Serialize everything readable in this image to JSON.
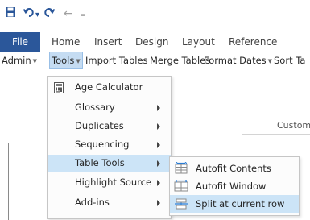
{
  "qat": {
    "save_icon": "save-icon",
    "undo_icon": "undo-icon",
    "undo_caret": "▾",
    "redo_icon": "redo-icon",
    "back_glyph": "←",
    "customize_glyph": "₌"
  },
  "ribbon": {
    "tabs": [
      "File",
      "Home",
      "Insert",
      "Design",
      "Layout",
      "Reference"
    ],
    "row": [
      "Admin",
      "Tools",
      "Import Tables",
      "Merge Tables",
      "Format Dates",
      "Sort Ta"
    ],
    "group_label": "Custom",
    "accent": "#2b579a"
  },
  "tools_menu": {
    "items": [
      {
        "label": "Age Calculator",
        "icon": "calculator-icon",
        "submenu": false
      },
      {
        "label": "Glossary",
        "submenu": true
      },
      {
        "label": "Duplicates",
        "submenu": true
      },
      {
        "label": "Sequencing",
        "submenu": true
      },
      {
        "label": "Table Tools",
        "submenu": true,
        "highlighted": true
      },
      {
        "label": "Highlight Source",
        "submenu": true
      },
      {
        "label": "Add-ins",
        "submenu": true
      }
    ]
  },
  "table_tools_submenu": {
    "items": [
      {
        "label": "Autofit Contents",
        "icon": "autofit-contents-icon"
      },
      {
        "label": "Autofit Window",
        "icon": "autofit-window-icon"
      },
      {
        "label": "Split at current row",
        "icon": "split-table-icon",
        "highlighted": true
      }
    ]
  }
}
